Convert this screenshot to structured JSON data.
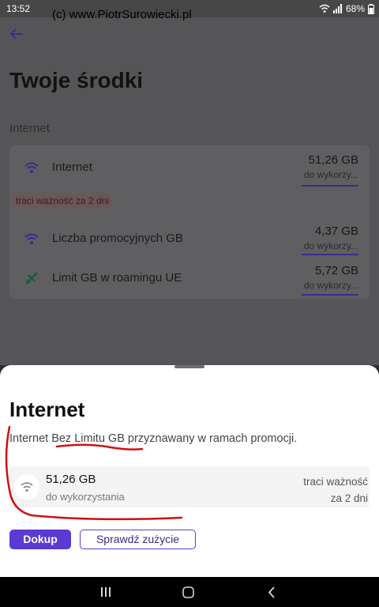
{
  "status": {
    "time": "13:52",
    "battery": "68%",
    "icons": [
      "wifi-icon",
      "signal-icon",
      "battery-icon"
    ]
  },
  "watermark": "(c) www.PiotrSurowiecki.pl",
  "page": {
    "title": "Twoje środki",
    "section": "Internet",
    "rows": [
      {
        "label": "Internet",
        "value": "51,26 GB",
        "sub": "do wykorzy...",
        "icon": "wifi-icon"
      },
      {
        "label": "Liczba promocyjnych GB",
        "value": "4,37 GB",
        "sub": "do wykorzy...",
        "icon": "wifi-icon"
      },
      {
        "label": "Limit GB w roamingu UE",
        "value": "5,72 GB",
        "sub": "do wykorzy...",
        "icon": "plane-icon"
      }
    ],
    "badge": "traci ważność za 2 dni"
  },
  "sheet": {
    "title": "Internet",
    "description": "Internet Bez Limitu GB przyznawany w ramach promocji.",
    "usage": {
      "value": "51,26 GB",
      "sub": "do wykorzystania",
      "expire_line1": "traci ważność",
      "expire_line2": "za 2 dni"
    },
    "buttons": {
      "topup": "Dokup",
      "check": "Sprawdź zużycie"
    }
  },
  "colors": {
    "accent": "#5a3ad2",
    "annotation": "#d01010"
  }
}
